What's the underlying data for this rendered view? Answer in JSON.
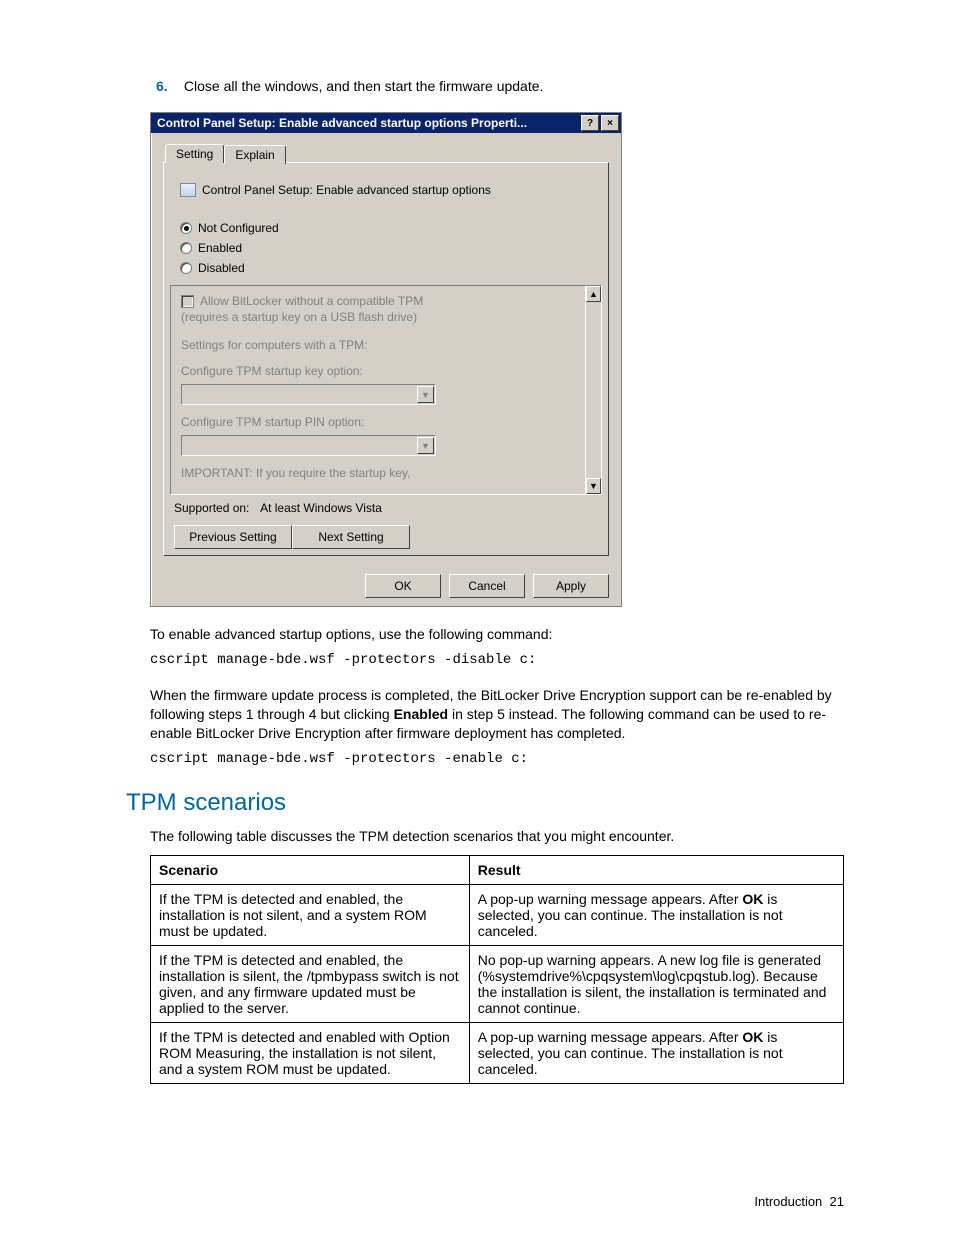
{
  "step": {
    "number": "6.",
    "text": "Close all the windows, and then start the firmware update."
  },
  "dialog": {
    "title": "Control Panel Setup: Enable advanced startup options Properti...",
    "help_glyph": "?",
    "close_glyph": "×",
    "tabs": {
      "setting": "Setting",
      "explain": "Explain"
    },
    "heading": "Control Panel Setup: Enable advanced startup options",
    "radios": {
      "not_configured": "Not Configured",
      "enabled": "Enabled",
      "disabled": "Disabled",
      "selected": "not_configured"
    },
    "options": {
      "checkbox_label": "Allow BitLocker without a compatible TPM",
      "checkbox_sub": "(requires a startup key on a USB flash drive)",
      "line_a": "Settings for computers with a TPM:",
      "line_b": "Configure TPM startup key option:",
      "line_c": "Configure TPM startup PIN option:",
      "important": "IMPORTANT: If you require the startup key,",
      "up_glyph": "▲",
      "down_glyph": "▼",
      "combo_glyph": "▼"
    },
    "supported": {
      "label": "Supported on:",
      "value": "At least Windows Vista"
    },
    "buttons": {
      "previous": "Previous Setting",
      "next": "Next Setting",
      "ok": "OK",
      "cancel": "Cancel",
      "apply": "Apply"
    }
  },
  "body": {
    "p1": "To enable advanced startup options, use the following command:",
    "code1": "cscript manage-bde.wsf -protectors -disable c:",
    "p2_a": "When the firmware update process is completed, the BitLocker Drive Encryption support can be re-enabled by following steps 1 through 4 but clicking ",
    "p2_bold": "Enabled",
    "p2_b": " in step 5 instead. The following command can be used to re-enable BitLocker Drive Encryption after firmware deployment has completed.",
    "code2": "cscript manage-bde.wsf -protectors -enable c:"
  },
  "section": {
    "title": "TPM scenarios",
    "intro": "The following table discusses the TPM detection scenarios that you might encounter.",
    "headers": {
      "scenario": "Scenario",
      "result": "Result"
    },
    "rows": [
      {
        "scenario": "If the TPM is detected and enabled, the installation is not silent, and a system ROM must be updated.",
        "result_a": "A pop-up warning message appears. After ",
        "result_bold": "OK",
        "result_b": " is selected, you can continue. The installation is not canceled."
      },
      {
        "scenario": "If the TPM is detected and enabled, the installation is silent, the /tpmbypass switch is not given, and any firmware updated must be applied to the server.",
        "result_plain": "No pop-up warning appears. A new log file is generated (%systemdrive%\\cpqsystem\\log\\cpqstub.log). Because the installation is silent, the installation is terminated and cannot continue."
      },
      {
        "scenario": "If the TPM is detected and enabled with Option ROM Measuring, the installation is not silent, and a system ROM must be updated.",
        "result_a": "A pop-up warning message appears. After ",
        "result_bold": "OK",
        "result_b": " is selected, you can continue. The installation is not canceled."
      }
    ]
  },
  "footer": {
    "section": "Introduction",
    "page": "21"
  }
}
